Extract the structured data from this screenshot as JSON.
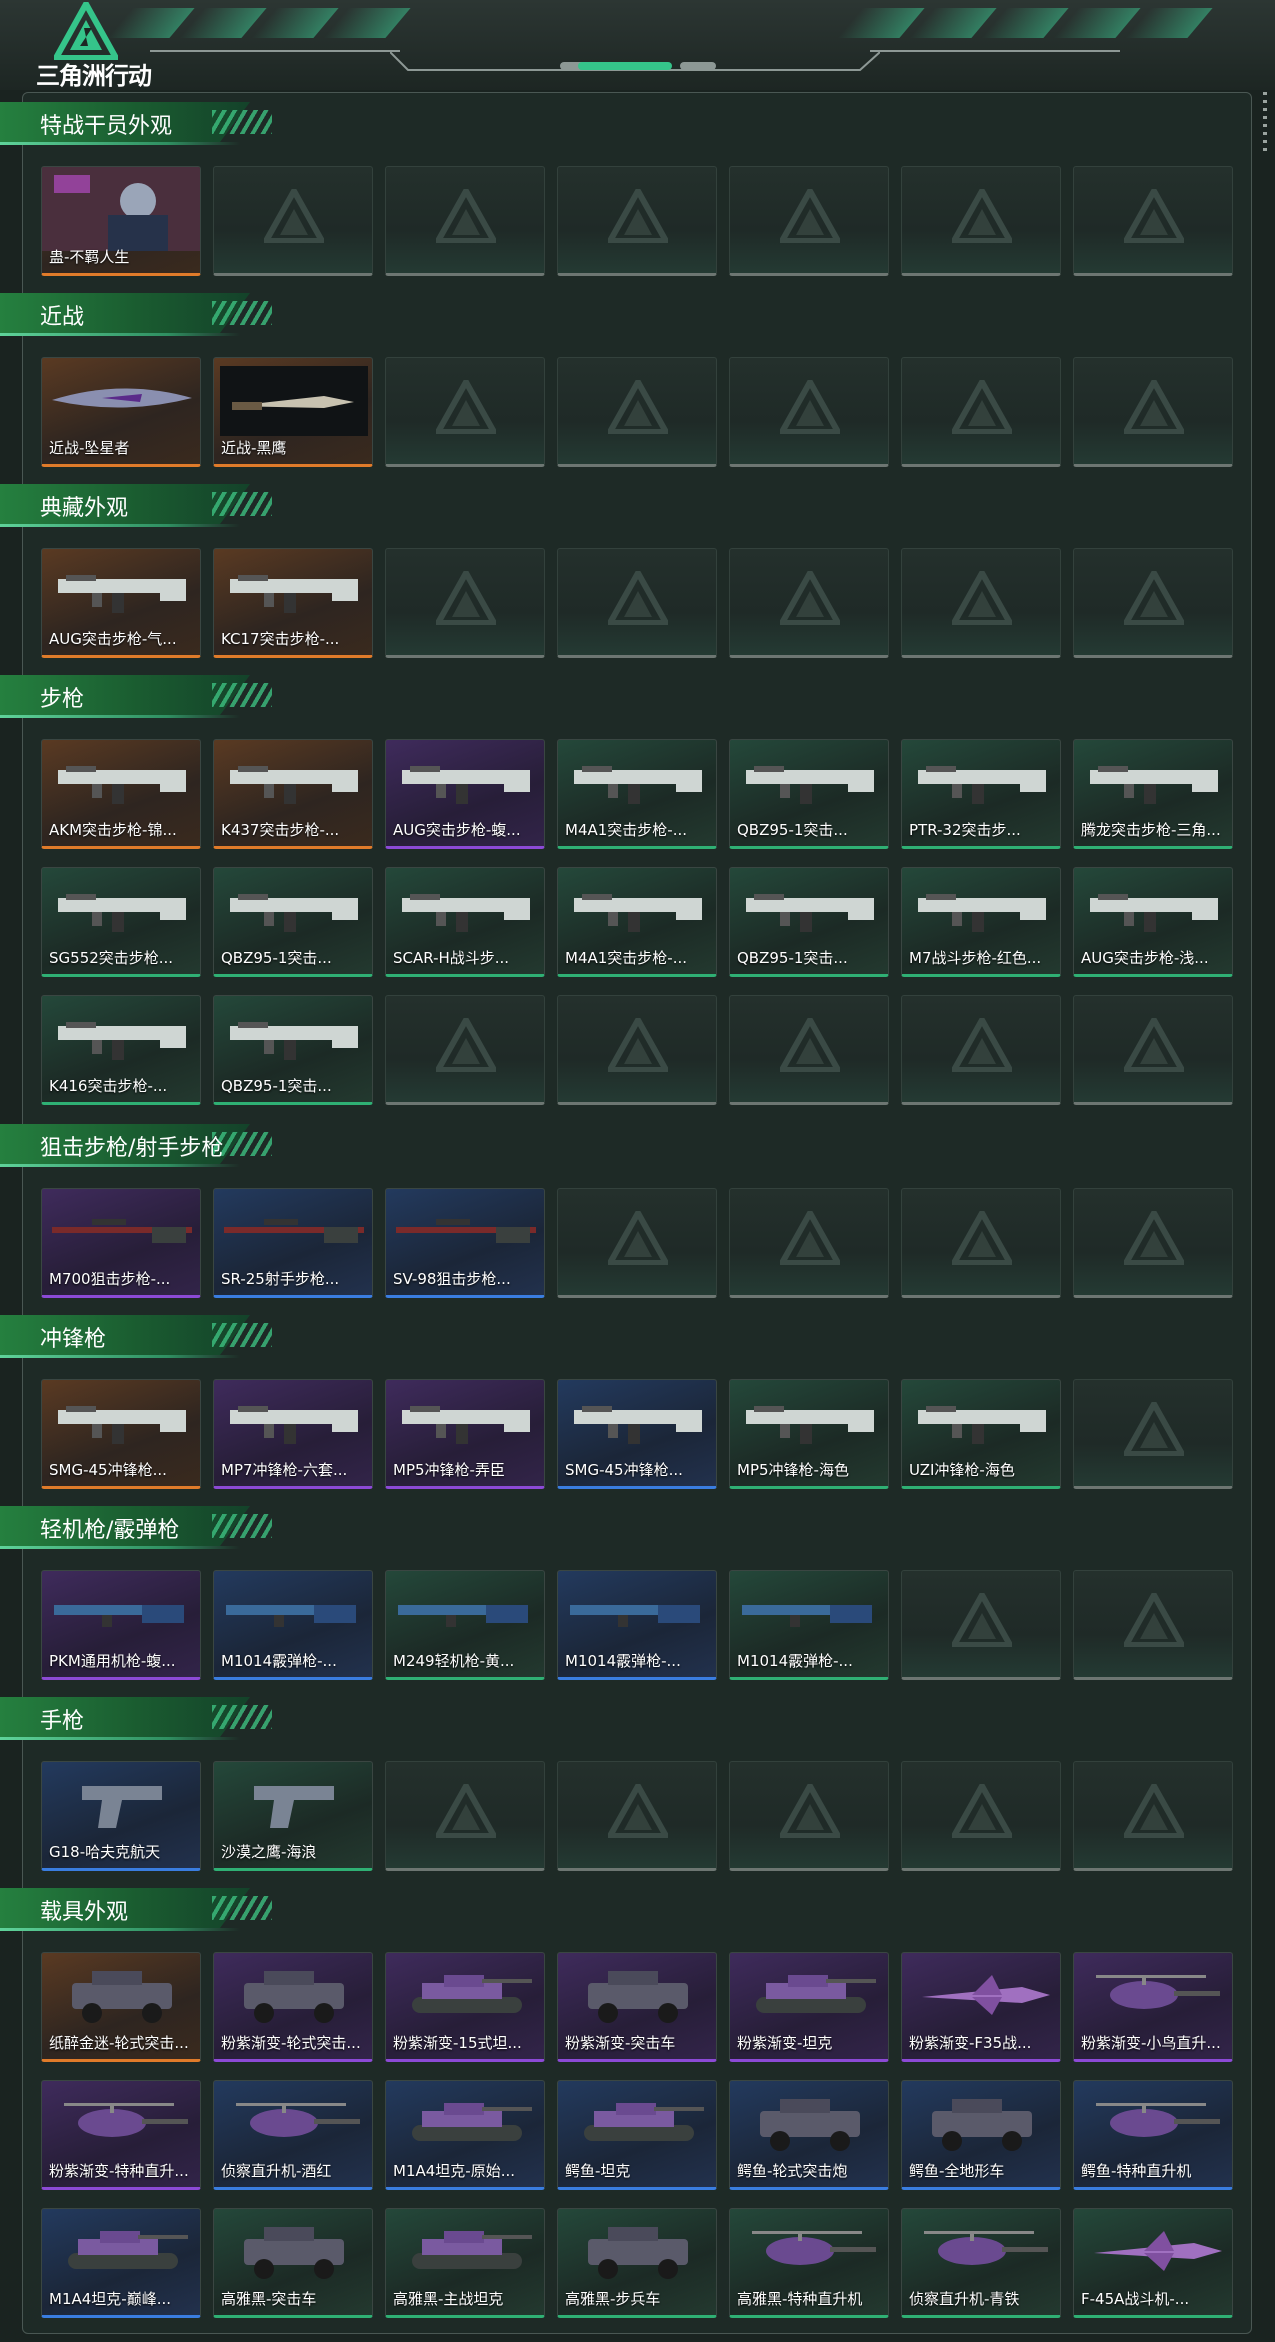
{
  "header": {
    "logo_text": "三角洲行动",
    "accent_color": "#35c48a"
  },
  "sections": [
    {
      "title": "特战干员外观",
      "items": [
        {
          "label": "蛊-不羁人生",
          "rarity": "orange",
          "icon": "operator-portrait"
        }
      ]
    },
    {
      "title": "近战",
      "items": [
        {
          "label": "近战-坠星者",
          "rarity": "orange",
          "icon": "melee-blade"
        },
        {
          "label": "近战-黑鹰",
          "rarity": "orange",
          "icon": "combat-knife"
        }
      ]
    },
    {
      "title": "典藏外观",
      "items": [
        {
          "label": "AUG突击步枪-气...",
          "rarity": "orange",
          "icon": "rifle"
        },
        {
          "label": "KC17突击步枪-...",
          "rarity": "orange",
          "icon": "rifle"
        }
      ]
    },
    {
      "title": "步枪",
      "items": [
        {
          "label": "AKM突击步枪-锦...",
          "rarity": "orange",
          "icon": "rifle"
        },
        {
          "label": "K437突击步枪-...",
          "rarity": "orange",
          "icon": "rifle"
        },
        {
          "label": "AUG突击步枪-蝮...",
          "rarity": "purple",
          "icon": "rifle"
        },
        {
          "label": "M4A1突击步枪-...",
          "rarity": "green",
          "icon": "rifle"
        },
        {
          "label": "QBZ95-1突击...",
          "rarity": "green",
          "icon": "rifle"
        },
        {
          "label": "PTR-32突击步...",
          "rarity": "green",
          "icon": "rifle"
        },
        {
          "label": "腾龙突击步枪-三角...",
          "rarity": "green",
          "icon": "rifle"
        },
        {
          "label": "SG552突击步枪...",
          "rarity": "green",
          "icon": "rifle"
        },
        {
          "label": "QBZ95-1突击...",
          "rarity": "green",
          "icon": "rifle"
        },
        {
          "label": "SCAR-H战斗步...",
          "rarity": "green",
          "icon": "rifle"
        },
        {
          "label": "M4A1突击步枪-...",
          "rarity": "green",
          "icon": "rifle"
        },
        {
          "label": "QBZ95-1突击...",
          "rarity": "green",
          "icon": "rifle"
        },
        {
          "label": "M7战斗步枪-红色...",
          "rarity": "green",
          "icon": "rifle"
        },
        {
          "label": "AUG突击步枪-浅...",
          "rarity": "green",
          "icon": "rifle"
        },
        {
          "label": "K416突击步枪-...",
          "rarity": "green",
          "icon": "rifle"
        },
        {
          "label": "QBZ95-1突击...",
          "rarity": "green",
          "icon": "rifle"
        }
      ]
    },
    {
      "title": "狙击步枪/射手步枪",
      "items": [
        {
          "label": "M700狙击步枪-...",
          "rarity": "purple",
          "icon": "sniper-rifle"
        },
        {
          "label": "SR-25射手步枪...",
          "rarity": "blue",
          "icon": "sniper-rifle"
        },
        {
          "label": "SV-98狙击步枪...",
          "rarity": "blue",
          "icon": "sniper-rifle"
        }
      ]
    },
    {
      "title": "冲锋枪",
      "items": [
        {
          "label": "SMG-45冲锋枪...",
          "rarity": "orange",
          "icon": "smg"
        },
        {
          "label": "MP7冲锋枪-六套...",
          "rarity": "purple",
          "icon": "smg"
        },
        {
          "label": "MP5冲锋枪-弄臣",
          "rarity": "purple",
          "icon": "smg"
        },
        {
          "label": "SMG-45冲锋枪...",
          "rarity": "blue",
          "icon": "smg"
        },
        {
          "label": "MP5冲锋枪-海色",
          "rarity": "green",
          "icon": "smg"
        },
        {
          "label": "UZI冲锋枪-海色",
          "rarity": "green",
          "icon": "smg"
        }
      ]
    },
    {
      "title": "轻机枪/霰弹枪",
      "items": [
        {
          "label": "PKM通用机枪-蝮...",
          "rarity": "purple",
          "icon": "machine-gun"
        },
        {
          "label": "M1014霰弹枪-...",
          "rarity": "blue",
          "icon": "shotgun"
        },
        {
          "label": "M249轻机枪-黄...",
          "rarity": "green",
          "icon": "machine-gun"
        },
        {
          "label": "M1014霰弹枪-...",
          "rarity": "blue",
          "icon": "shotgun"
        },
        {
          "label": "M1014霰弹枪-...",
          "rarity": "green",
          "icon": "shotgun"
        }
      ]
    },
    {
      "title": "手枪",
      "items": [
        {
          "label": "G18-哈夫克航天",
          "rarity": "blue",
          "icon": "pistol"
        },
        {
          "label": "沙漠之鹰-海浪",
          "rarity": "green",
          "icon": "pistol"
        }
      ]
    },
    {
      "title": "载具外观",
      "items": [
        {
          "label": "纸醉金迷-轮式突击...",
          "rarity": "orange",
          "icon": "vehicle"
        },
        {
          "label": "粉紫渐变-轮式突击...",
          "rarity": "purple",
          "icon": "vehicle"
        },
        {
          "label": "粉紫渐变-15式坦...",
          "rarity": "purple",
          "icon": "tank"
        },
        {
          "label": "粉紫渐变-突击车",
          "rarity": "purple",
          "icon": "vehicle"
        },
        {
          "label": "粉紫渐变-坦克",
          "rarity": "purple",
          "icon": "tank"
        },
        {
          "label": "粉紫渐变-F35战...",
          "rarity": "purple",
          "icon": "jet"
        },
        {
          "label": "粉紫渐变-小鸟直升...",
          "rarity": "purple",
          "icon": "helicopter"
        },
        {
          "label": "粉紫渐变-特种直升...",
          "rarity": "purple",
          "icon": "helicopter"
        },
        {
          "label": "侦察直升机-酒红",
          "rarity": "blue",
          "icon": "helicopter"
        },
        {
          "label": "M1A4坦克-原始...",
          "rarity": "blue",
          "icon": "tank"
        },
        {
          "label": "鳄鱼-坦克",
          "rarity": "blue",
          "icon": "tank"
        },
        {
          "label": "鳄鱼-轮式突击炮",
          "rarity": "blue",
          "icon": "vehicle"
        },
        {
          "label": "鳄鱼-全地形车",
          "rarity": "blue",
          "icon": "vehicle"
        },
        {
          "label": "鳄鱼-特种直升机",
          "rarity": "blue",
          "icon": "helicopter"
        },
        {
          "label": "M1A4坦克-巅峰...",
          "rarity": "blue",
          "icon": "tank"
        },
        {
          "label": "高雅黑-突击车",
          "rarity": "green",
          "icon": "vehicle"
        },
        {
          "label": "高雅黑-主战坦克",
          "rarity": "green",
          "icon": "tank"
        },
        {
          "label": "高雅黑-步兵车",
          "rarity": "green",
          "icon": "vehicle"
        },
        {
          "label": "高雅黑-特种直升机",
          "rarity": "green",
          "icon": "helicopter"
        },
        {
          "label": "侦察直升机-青铁",
          "rarity": "green",
          "icon": "helicopter"
        },
        {
          "label": "F-45A战斗机-...",
          "rarity": "green",
          "icon": "jet"
        }
      ]
    }
  ]
}
